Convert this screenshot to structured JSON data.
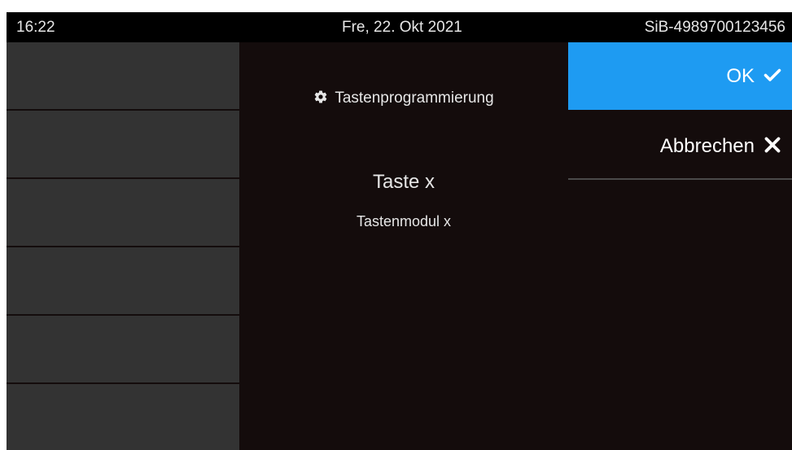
{
  "status_bar": {
    "time": "16:22",
    "date": "Fre, 22. Okt 2021",
    "device": "SiB-4989700123456"
  },
  "screen": {
    "section_title": "Tastenprogrammierung",
    "section_icon": "gear-icon",
    "key_title": "Taste x",
    "key_module": "Tastenmodul x"
  },
  "key_slots": [
    "",
    "",
    "",
    "",
    "",
    ""
  ],
  "actions": {
    "ok_label": "OK",
    "ok_icon": "checkmark-icon",
    "cancel_label": "Abbrechen",
    "cancel_icon": "close-icon"
  },
  "colors": {
    "background": "#140c0c",
    "status_bar": "#000000",
    "key_slot": "#333333",
    "accent": "#1e9bf2",
    "text": "#e6e6e6"
  }
}
